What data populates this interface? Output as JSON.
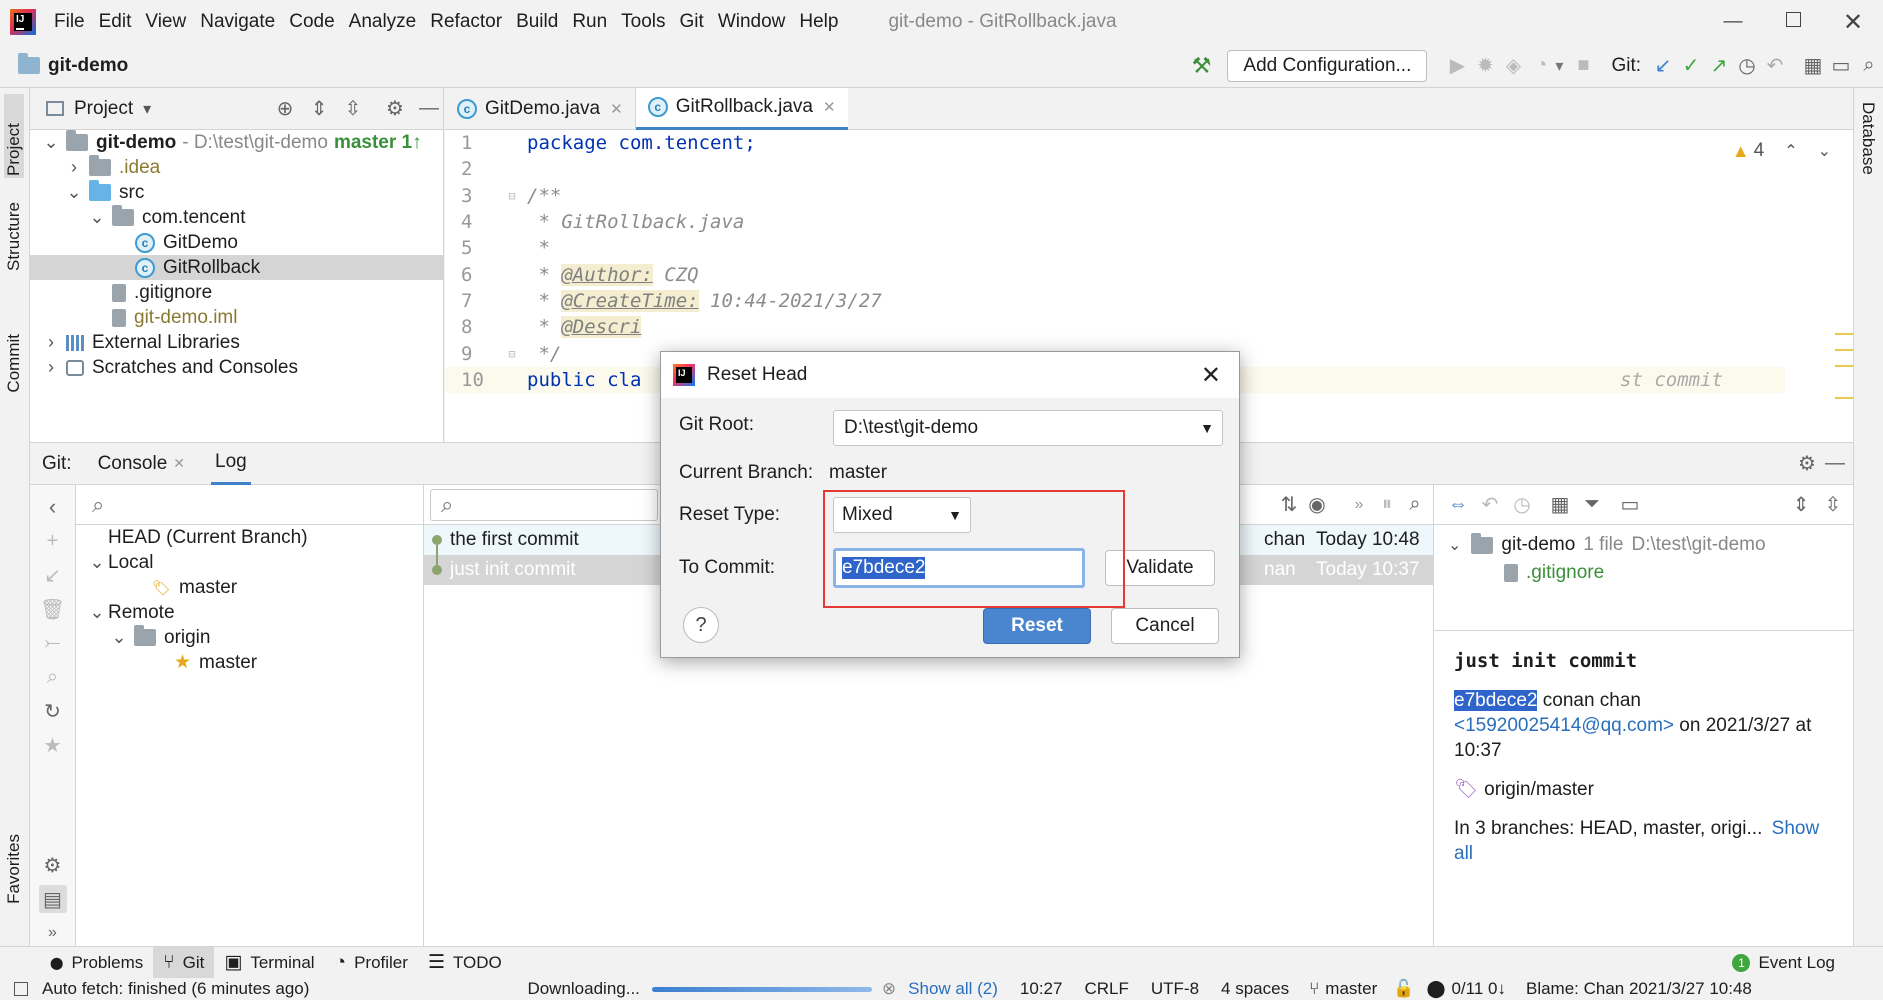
{
  "menu": {
    "items": [
      "File",
      "Edit",
      "View",
      "Navigate",
      "Code",
      "Analyze",
      "Refactor",
      "Build",
      "Run",
      "Tools",
      "Git",
      "Window",
      "Help"
    ],
    "window_title": "git-demo - GitRollback.java"
  },
  "navbar": {
    "project": "git-demo",
    "add_config": "Add Configuration...",
    "git_label": "Git:"
  },
  "project_panel": {
    "title": "Project",
    "tree": [
      {
        "label": "git-demo",
        "suffix": " - D:\\test\\git-demo",
        "branch": "master 1↑"
      },
      {
        "label": ".idea"
      },
      {
        "label": "src"
      },
      {
        "label": "com.tencent"
      },
      {
        "label": "GitDemo"
      },
      {
        "label": "GitRollback"
      },
      {
        "label": ".gitignore"
      },
      {
        "label": "git-demo.iml"
      },
      {
        "label": "External Libraries"
      },
      {
        "label": "Scratches and Consoles"
      }
    ]
  },
  "left_strip": {
    "project": "Project",
    "structure": "Structure",
    "commit": "Commit",
    "favorites": "Favorites"
  },
  "right_strip": {
    "database": "Database"
  },
  "editor": {
    "tabs": [
      {
        "label": "GitDemo.java"
      },
      {
        "label": "GitRollback.java"
      }
    ],
    "warnings": "4",
    "lines": [
      {
        "n": "1",
        "text": "package com.tencent;"
      },
      {
        "n": "2",
        "text": ""
      },
      {
        "n": "3",
        "text": "/**"
      },
      {
        "n": "4",
        "text": " * GitRollback.java"
      },
      {
        "n": "5",
        "text": " *"
      },
      {
        "n": "6",
        "tag": "@Author:",
        "rest": " CZQ"
      },
      {
        "n": "7",
        "tag": "@CreateTime:",
        "rest": " 10:44-2021/3/27"
      },
      {
        "n": "8",
        "tag": "@Descri",
        "rest": ""
      },
      {
        "n": "9",
        "text": " */"
      },
      {
        "n": "10",
        "text": "public cla"
      }
    ],
    "hint": "st commit"
  },
  "git_tool": {
    "label": "Git:",
    "console_tab": "Console",
    "log_tab": "Log",
    "branches": [
      {
        "label": "HEAD (Current Branch)"
      },
      {
        "label": "Local"
      },
      {
        "label": "master"
      },
      {
        "label": "Remote"
      },
      {
        "label": "origin"
      },
      {
        "label": "master"
      }
    ],
    "commits": [
      {
        "msg": "the first commit",
        "author": "chan",
        "date": "Today 10:48"
      },
      {
        "msg": "just init commit",
        "author": "nan",
        "date": "Today 10:37"
      }
    ],
    "changes": {
      "root": "git-demo",
      "count": "1 file",
      "path": "D:\\test\\git-demo",
      "file": ".gitignore"
    },
    "detail": {
      "title": "just init commit",
      "hash": "e7bdece2",
      "author": " conan chan",
      "email": "<15920025414@qq.com>",
      "on": " on 2021/3/27 at",
      "time": "10:37",
      "ref": "origin/master",
      "branches_text": "In 3 branches: HEAD, master, origi...",
      "show_all": "Show all"
    }
  },
  "dialog": {
    "title": "Reset Head",
    "git_root_label": "Git Root:",
    "git_root_value": "D:\\test\\git-demo",
    "branch_label": "Current Branch:",
    "branch_value": "master",
    "reset_type_label": "Reset Type:",
    "reset_type_value": "Mixed",
    "to_commit_label": "To Commit:",
    "to_commit_value": "e7bdece2",
    "validate": "Validate",
    "reset": "Reset",
    "cancel": "Cancel",
    "help": "?"
  },
  "bottom_tabs": [
    {
      "label": "Problems"
    },
    {
      "label": "Git"
    },
    {
      "label": "Terminal"
    },
    {
      "label": "Profiler"
    },
    {
      "label": "TODO"
    }
  ],
  "event_log": {
    "label": "Event Log",
    "count": "1"
  },
  "status": {
    "left": "Auto fetch: finished (6 minutes ago)",
    "downloading": "Downloading...",
    "show_all": "Show all (2)",
    "pos": "10:27",
    "crlf": "CRLF",
    "enc": "UTF-8",
    "indent": "4 spaces",
    "branch": "master",
    "blame": "Blame: Chan 2021/3/27 10:48",
    "counts": "0/11 0↓"
  },
  "colors": {
    "accent": "#3574f0",
    "highlight": "#e53935",
    "select_blue": "#2f65ca"
  }
}
